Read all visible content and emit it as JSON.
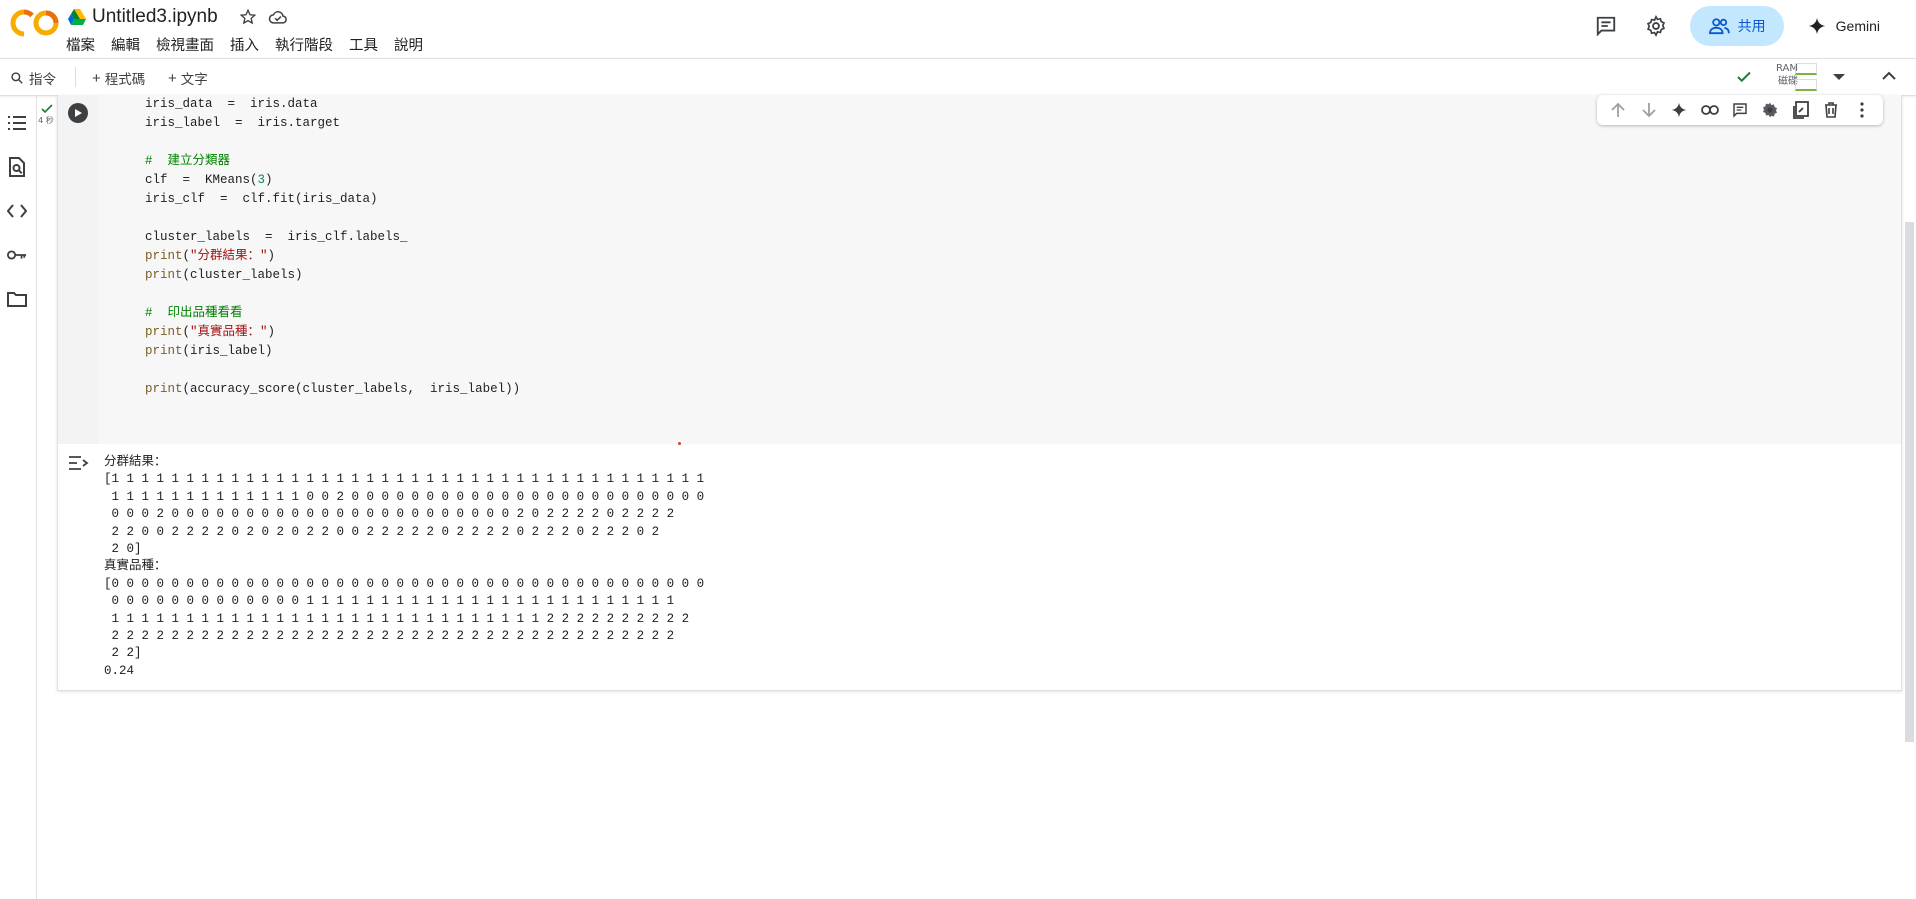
{
  "app": {
    "logo_text": "CO",
    "notebook_title": "Untitled3.ipynb"
  },
  "menu": [
    "檔案",
    "編輯",
    "檢視畫面",
    "插入",
    "執行階段",
    "工具",
    "說明"
  ],
  "header_right": {
    "share_label": "共用",
    "gemini_label": "Gemini"
  },
  "toolbar": {
    "command_label": "指令",
    "add_code_label": "程式碼",
    "add_text_label": "文字",
    "ram_label": "RAM",
    "disk_label": "磁碟"
  },
  "cell": {
    "exec_time": "4 秒",
    "code_lines": [
      [
        {
          "t": "iris_data  =  iris.data"
        }
      ],
      [
        {
          "t": "iris_label  =  iris.target"
        }
      ],
      [
        {
          "t": ""
        }
      ],
      [
        {
          "t": "#  建立分類器",
          "c": "c-comment"
        }
      ],
      [
        {
          "t": "clf  =  KMeans("
        },
        {
          "t": "3",
          "c": "c-num"
        },
        {
          "t": ")"
        }
      ],
      [
        {
          "t": "iris_clf  =  clf.fit(iris_data)"
        }
      ],
      [
        {
          "t": ""
        }
      ],
      [
        {
          "t": "cluster_labels  =  iris_clf.labels_"
        }
      ],
      [
        {
          "t": "print",
          "c": "c-builtin"
        },
        {
          "t": "("
        },
        {
          "t": "\"分群結果：\"",
          "c": "c-str"
        },
        {
          "t": ")"
        }
      ],
      [
        {
          "t": "print",
          "c": "c-builtin"
        },
        {
          "t": "(cluster_labels)"
        }
      ],
      [
        {
          "t": ""
        }
      ],
      [
        {
          "t": "#  印出品種看看",
          "c": "c-comment"
        }
      ],
      [
        {
          "t": "print",
          "c": "c-builtin"
        },
        {
          "t": "("
        },
        {
          "t": "\"真實品種：\"",
          "c": "c-str"
        },
        {
          "t": ")"
        }
      ],
      [
        {
          "t": "print",
          "c": "c-builtin"
        },
        {
          "t": "(iris_label)"
        }
      ],
      [
        {
          "t": ""
        }
      ],
      [
        {
          "t": "print",
          "c": "c-builtin"
        },
        {
          "t": "(accuracy_score(cluster_labels,  iris_label))"
        }
      ]
    ],
    "output_lines": [
      "分群結果：",
      "[1 1 1 1 1 1 1 1 1 1 1 1 1 1 1 1 1 1 1 1 1 1 1 1 1 1 1 1 1 1 1 1 1 1 1 1 1 1 1 1",
      " 1 1 1 1 1 1 1 1 1 1 1 1 1 0 0 2 0 0 0 0 0 0 0 0 0 0 0 0 0 0 0 0 0 0 0 0 0 0 0 0",
      " 0 0 0 2 0 0 0 0 0 0 0 0 0 0 0 0 0 0 0 0 0 0 0 0 0 0 0 2 0 2 2 2 2 0 2 2 2 2",
      " 2 2 0 0 2 2 2 2 0 2 0 2 0 2 2 0 0 2 2 2 2 2 0 2 2 2 2 0 2 2 2 0 2 2 2 0 2",
      " 2 0]",
      "真實品種：",
      "[0 0 0 0 0 0 0 0 0 0 0 0 0 0 0 0 0 0 0 0 0 0 0 0 0 0 0 0 0 0 0 0 0 0 0 0 0 0 0 0",
      " 0 0 0 0 0 0 0 0 0 0 0 0 0 1 1 1 1 1 1 1 1 1 1 1 1 1 1 1 1 1 1 1 1 1 1 1 1 1",
      " 1 1 1 1 1 1 1 1 1 1 1 1 1 1 1 1 1 1 1 1 1 1 1 1 1 1 1 1 1 2 2 2 2 2 2 2 2 2 2",
      " 2 2 2 2 2 2 2 2 2 2 2 2 2 2 2 2 2 2 2 2 2 2 2 2 2 2 2 2 2 2 2 2 2 2 2 2 2 2",
      " 2 2]",
      "0.24"
    ]
  },
  "colors": {
    "share_bg": "#c2e7ff",
    "share_fg": "#0b57d0",
    "check_green": "#188038"
  }
}
